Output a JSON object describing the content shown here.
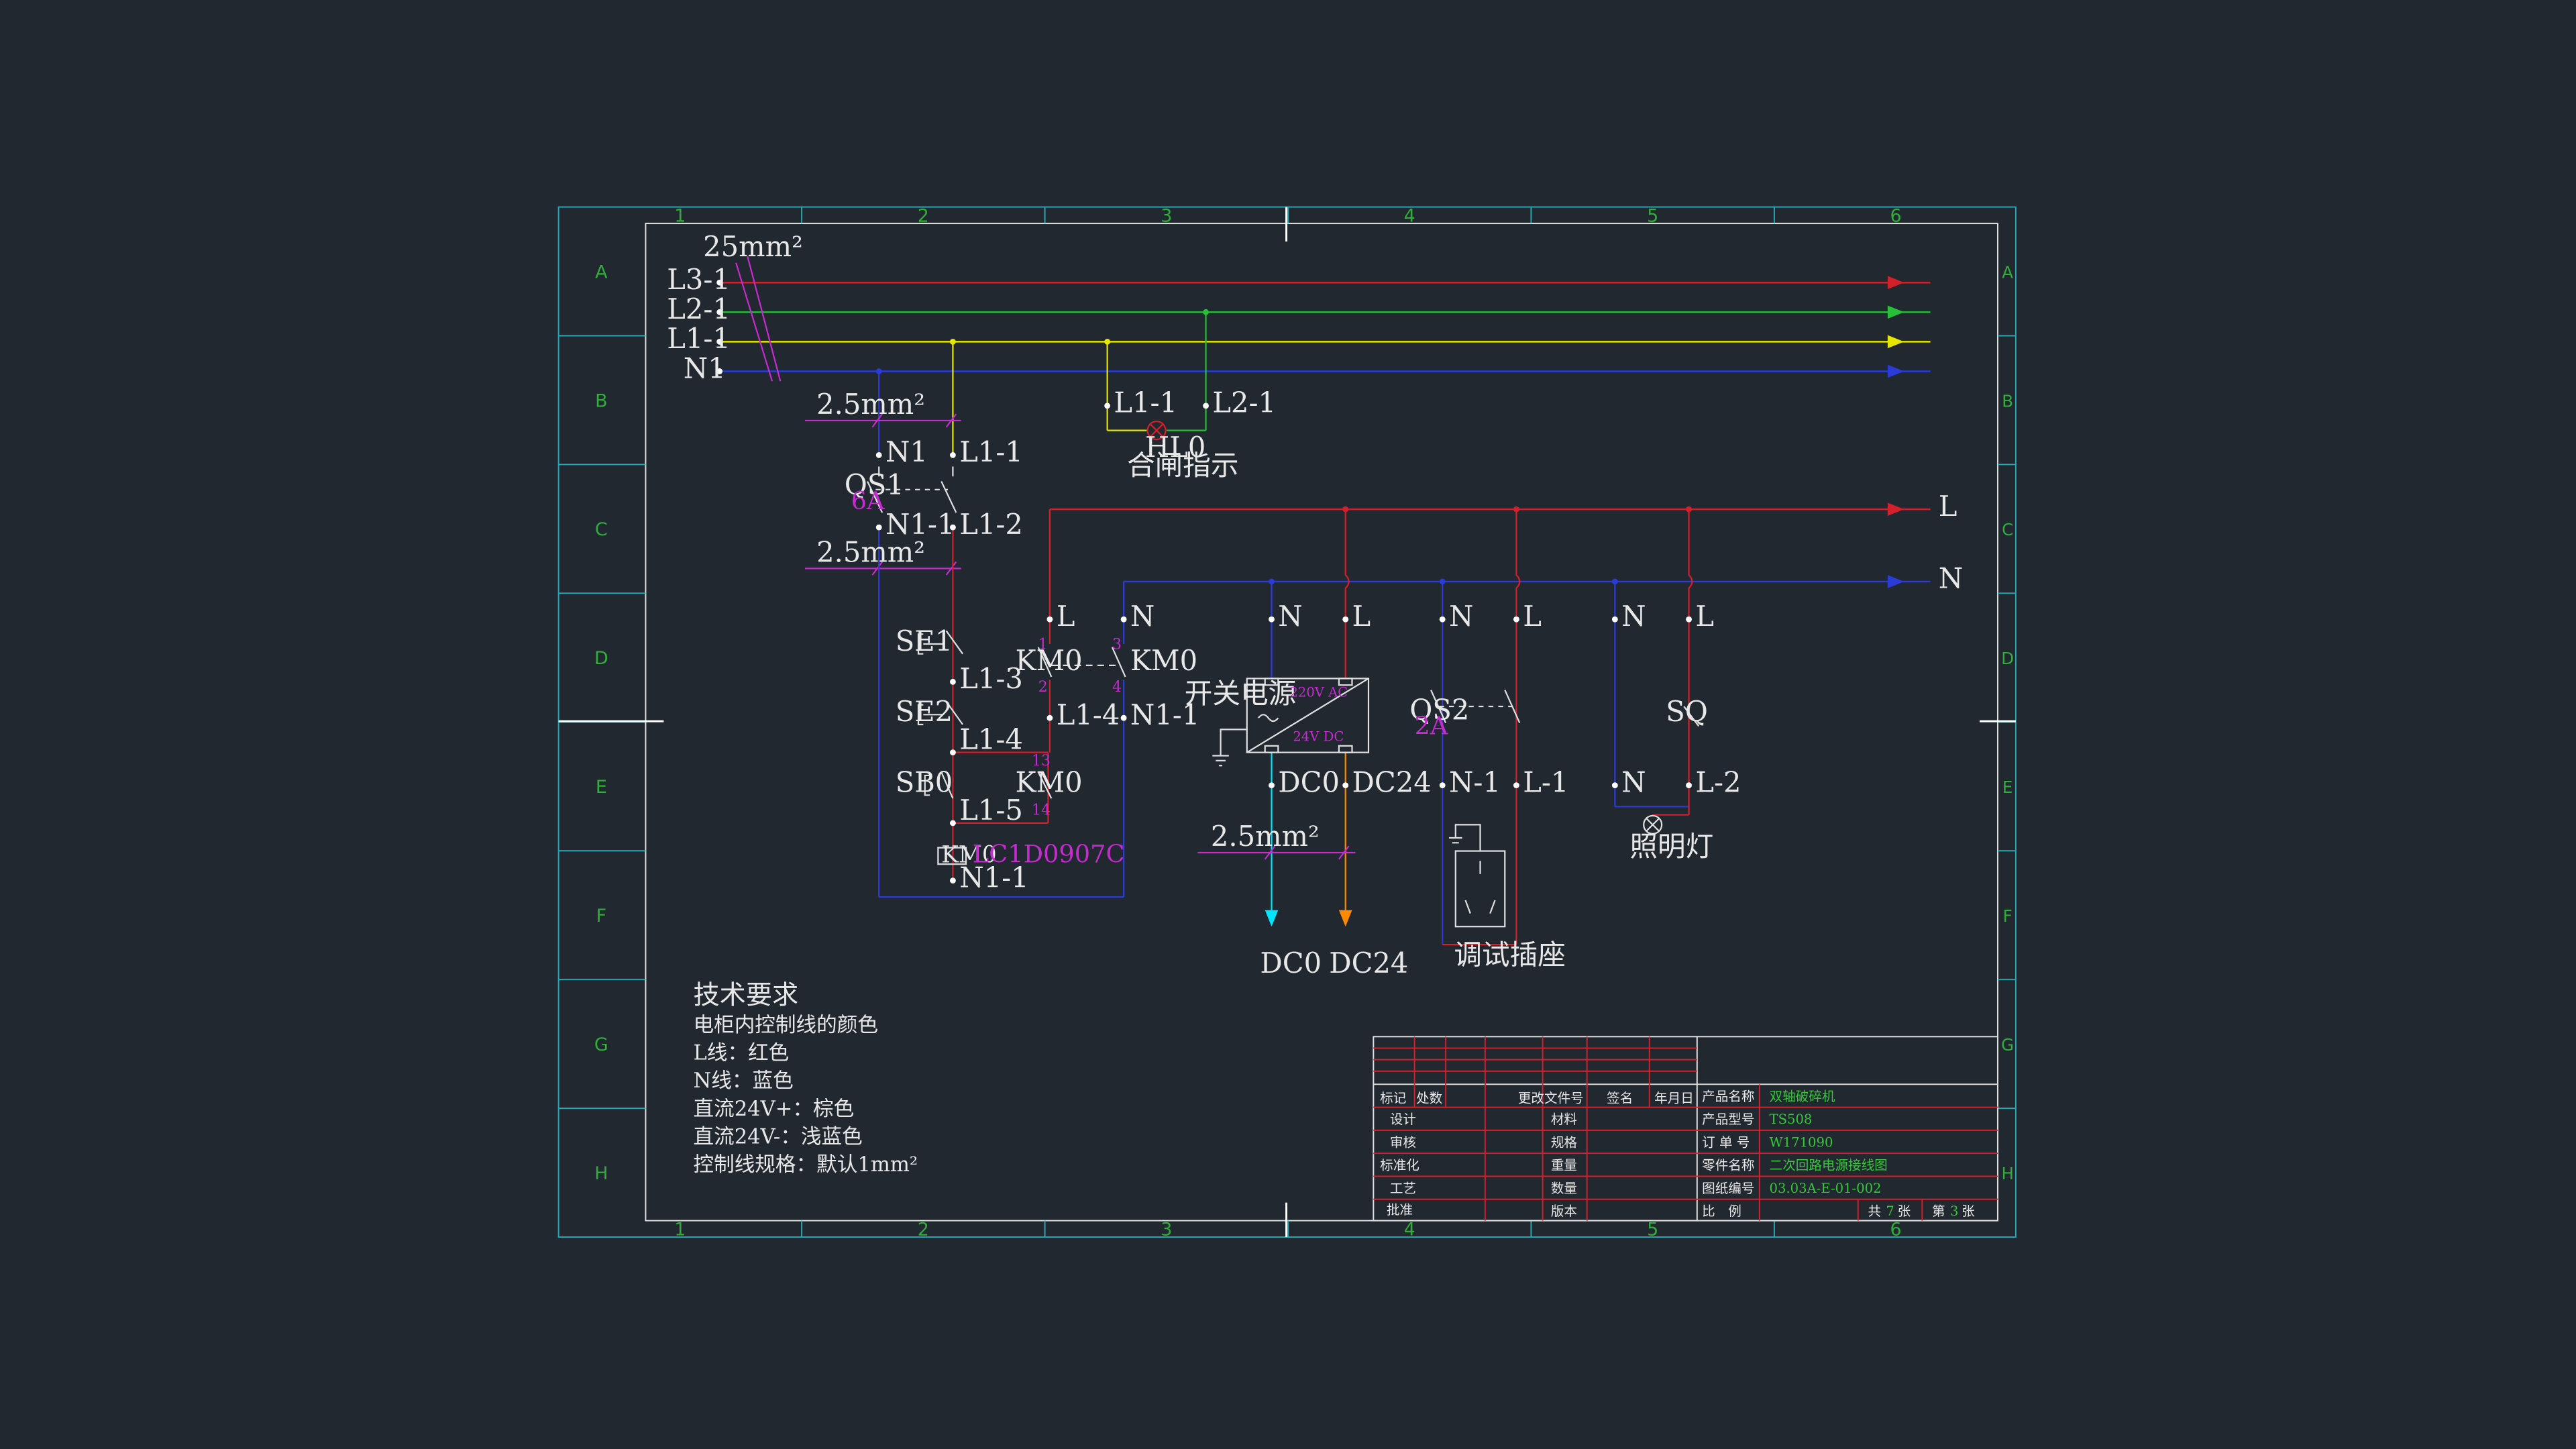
{
  "colors": {
    "background": "#212830",
    "frame": "#2aa7b2",
    "L": "#d4202a",
    "N": "#2a3bd8",
    "L1": "#e6e600",
    "L2": "#28c038",
    "wire_white": "#e0e0e0",
    "spec": "#c62bd0",
    "dc0": "#00e5ff",
    "dc24": "#ff8a00",
    "zone_text": "#2fae3a"
  },
  "icons": [
    "arrow-icon",
    "lamp-icon",
    "ground-icon",
    "socket-icon",
    "power-supply-icon",
    "switch-icon"
  ],
  "zones": {
    "cols": [
      "1",
      "2",
      "3",
      "4",
      "5",
      "6"
    ],
    "rows": [
      "A",
      "B",
      "C",
      "D",
      "E",
      "F",
      "G",
      "H"
    ]
  },
  "bus": {
    "cable": "25mm²",
    "lines": [
      "L3-1",
      "L2-1",
      "L1-1",
      "N1"
    ]
  },
  "left": {
    "spec1": "2.5mm²",
    "n1": "N1",
    "l1_1": "L1-1",
    "qs1": "QS1",
    "qs1_rating": "6A",
    "n1_1": "N1-1",
    "l1_2": "L1-2",
    "spec2": "2.5mm²",
    "se1": "SE1",
    "l1_3": "L1-3",
    "se2": "SE2",
    "l1_4": "L1-4",
    "sb0": "SB0",
    "l1_5": "L1-5",
    "km0_coil": "KM0",
    "km0_model": "LC1D0907C",
    "n1_1b": "N1-1"
  },
  "indicator": {
    "l1": "L1-1",
    "l2": "L2-1",
    "code": "HL0",
    "name": "合闸指示"
  },
  "contactor": {
    "l": "L",
    "n": "N",
    "km0_left": "KM0",
    "km0_right": "KM0",
    "pin1": "1",
    "pin2": "2",
    "pin3": "3",
    "pin4": "4",
    "l1_4": "L1-4",
    "n1_1": "N1-1",
    "aux_km0": "KM0",
    "pin13": "13",
    "pin14": "14"
  },
  "power_supply": {
    "name": "开关电源",
    "n": "N",
    "l": "L",
    "ac": "220V AC",
    "dc": "24V DC",
    "dc0": "DC0",
    "dc24": "DC24",
    "spec": "2.5mm²",
    "out_dc0": "DC0",
    "out_dc24": "DC24"
  },
  "right": {
    "bus_l": "L",
    "bus_n": "N",
    "n_a": "N",
    "l_a": "L",
    "qs2": "QS2",
    "qs2_rating": "2A",
    "n1": "N-1",
    "l1": "L-1",
    "socket": "调试插座",
    "n_b": "N",
    "l_b": "L",
    "sq": "SQ",
    "n_c": "N",
    "l2": "L-2",
    "lamp": "照明灯"
  },
  "requirements": {
    "title": "技术要求",
    "lines": [
      "电柜内控制线的颜色",
      "L线：红色",
      "N线：蓝色",
      "直流24V+：棕色",
      "直流24V-：浅蓝色",
      "控制线规格：默认1mm²"
    ]
  },
  "title_block": {
    "hdr_mark": "标记",
    "hdr_count": "处数",
    "hdr_doc": "更改文件号",
    "hdr_sign": "签名",
    "hdr_date": "年月日",
    "design": "设计",
    "review": "审核",
    "standard": "标准化",
    "process": "工艺",
    "approve": "批准",
    "material": "材料",
    "spec": "规格",
    "weight": "重量",
    "quantity": "数量",
    "version": "版本",
    "product_name_label": "产品名称",
    "product_name": "双轴破碎机",
    "model_label": "产品型号",
    "model": "TS508",
    "order_label": "订 单 号",
    "order": "W171090",
    "part_label": "零件名称",
    "part": "二次回路电源接线图",
    "drawing_label": "图纸编号",
    "drawing": "03.03A-E-01-002",
    "scale_label": "比　例",
    "total_pre": "共",
    "total": "7",
    "total_suf": "张",
    "sheet_pre": "第",
    "sheet": "3",
    "sheet_suf": "张"
  }
}
